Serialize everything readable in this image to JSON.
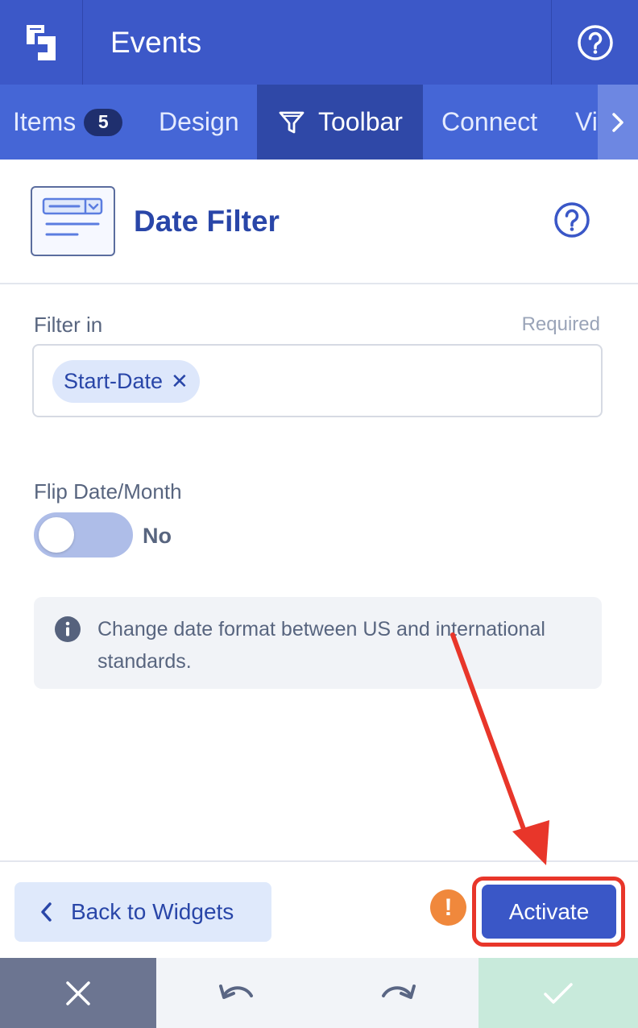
{
  "header": {
    "title": "Events",
    "logo_icon": "app-logo-icon",
    "help_icon": "help-circle-icon"
  },
  "tabs": [
    {
      "label": "Items",
      "badge": "5",
      "active": false
    },
    {
      "label": "Design",
      "active": false
    },
    {
      "label": "Toolbar",
      "icon": "filter-icon",
      "active": true
    },
    {
      "label": "Connect",
      "active": false
    },
    {
      "label": "Vi",
      "active": false
    }
  ],
  "widget": {
    "title": "Date Filter",
    "icon": "date-filter-widget-icon",
    "help_icon": "help-circle-icon"
  },
  "form": {
    "filter_label": "Filter in",
    "required_text": "Required",
    "chips": [
      {
        "label": "Start-Date",
        "remove_symbol": "✕"
      }
    ],
    "flip_label": "Flip Date/Month",
    "flip_value": "No",
    "flip_on": false,
    "info_text": "Change date format between US and international standards."
  },
  "footer": {
    "back_label": "Back to Widgets",
    "warning_symbol": "!",
    "activate_label": "Activate"
  },
  "bottom_bar": [
    "close-icon",
    "undo-icon",
    "redo-icon",
    "check-icon"
  ],
  "colors": {
    "primary": "#3c58c8",
    "tab_active": "#2f48a7",
    "annotation": "#e8362a",
    "warning": "#f0883c",
    "confirm": "#c8eadb"
  }
}
